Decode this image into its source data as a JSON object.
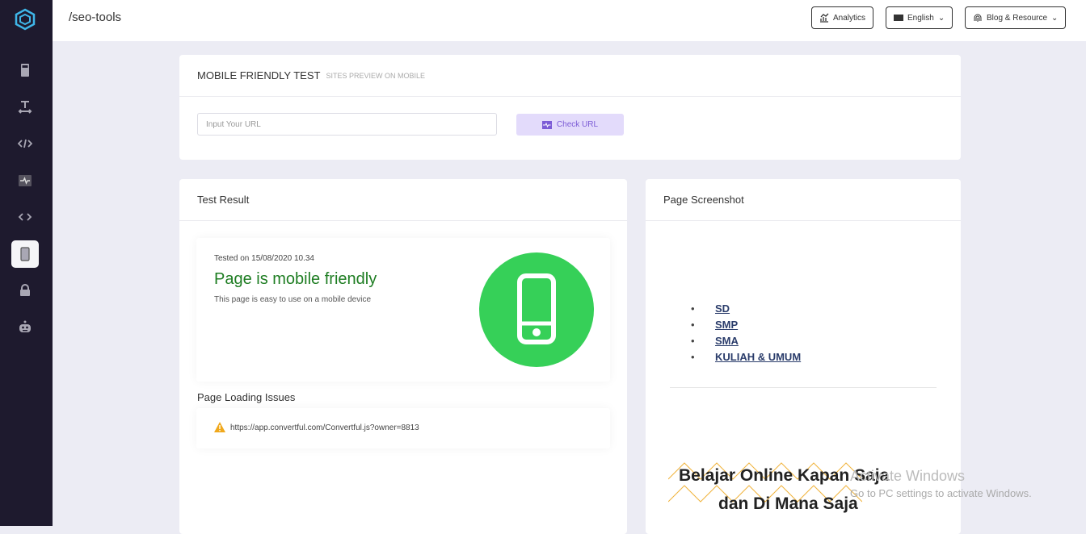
{
  "topbar": {
    "breadcrumb": "/seo-tools",
    "analytics": "Analytics",
    "language": "English",
    "blog": "Blog & Resource"
  },
  "sidebar": {
    "items": [
      {
        "name": "calculator-icon"
      },
      {
        "name": "text-width-icon"
      },
      {
        "name": "code-slash-icon"
      },
      {
        "name": "pulse-icon"
      },
      {
        "name": "code-icon"
      },
      {
        "name": "mobile-icon",
        "active": true
      },
      {
        "name": "lock-icon"
      },
      {
        "name": "robot-icon"
      }
    ]
  },
  "test": {
    "title": "MOBILE FRIENDLY TEST",
    "subtitle": "SITES PREVIEW ON MOBILE",
    "placeholder": "Input Your URL",
    "button": "Check URL"
  },
  "result": {
    "title": "Test Result",
    "tested_on": "Tested on 15/08/2020 10.34",
    "headline": "Page is mobile friendly",
    "desc": "This page is easy to use on a mobile device",
    "headline_color": "#1e7d22",
    "badge_color": "#36d058"
  },
  "issues": {
    "title": "Page Loading Issues",
    "items": [
      "https://app.convertful.com/Convertful.js?owner=8813"
    ]
  },
  "screenshot": {
    "title": "Page Screenshot",
    "links": [
      "SD",
      "SMP",
      "SMA",
      "KULIAH & UMUM"
    ],
    "banner_line1": "Belajar Online Kapan Saja",
    "banner_line2": "dan Di Mana Saja"
  },
  "watermark": {
    "line1": "Activate Windows",
    "line2": "Go to PC settings to activate Windows."
  }
}
